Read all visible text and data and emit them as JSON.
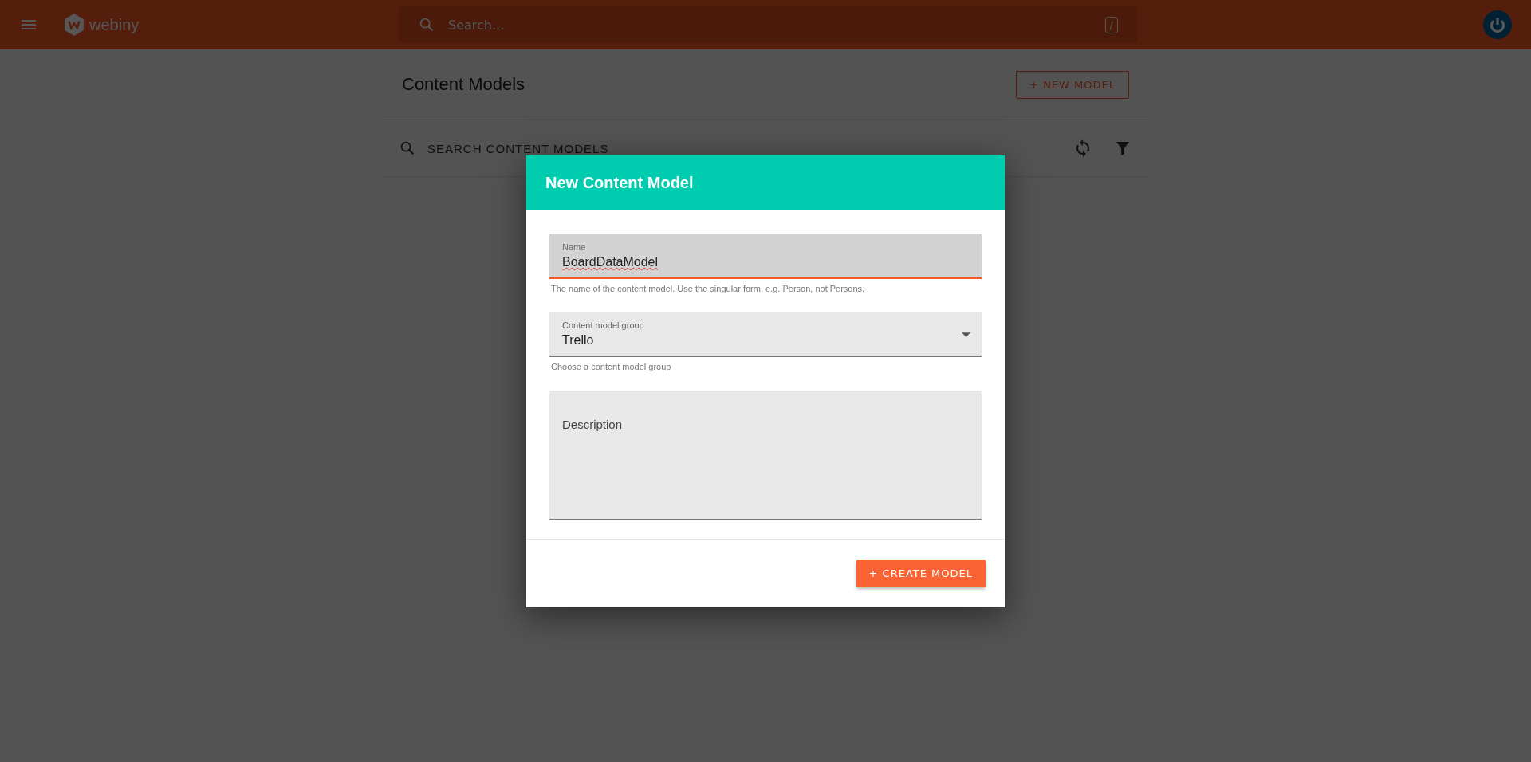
{
  "top_bar": {
    "logo_text": "webiny",
    "search": {
      "placeholder": "Search...",
      "shortcut": "/"
    }
  },
  "page": {
    "title": "Content Models",
    "new_button": "+ NEW MODEL",
    "search": {
      "placeholder": "SEARCH CONTENT MODELS"
    }
  },
  "dialog": {
    "title": "New Content Model",
    "fields": [
      {
        "kind": "text",
        "label": "Name",
        "value": "BoardDataModel",
        "helper": "The name of the content model. Use the singular form, e.g. Person, not Persons.",
        "focused": true
      },
      {
        "kind": "select",
        "label": "Content model group",
        "value": "Trello",
        "helper": "Choose a content model group",
        "focused": false
      },
      {
        "kind": "textarea",
        "label": "Description",
        "focused": false
      }
    ],
    "submit_button": "+ CREATE MODEL"
  }
}
